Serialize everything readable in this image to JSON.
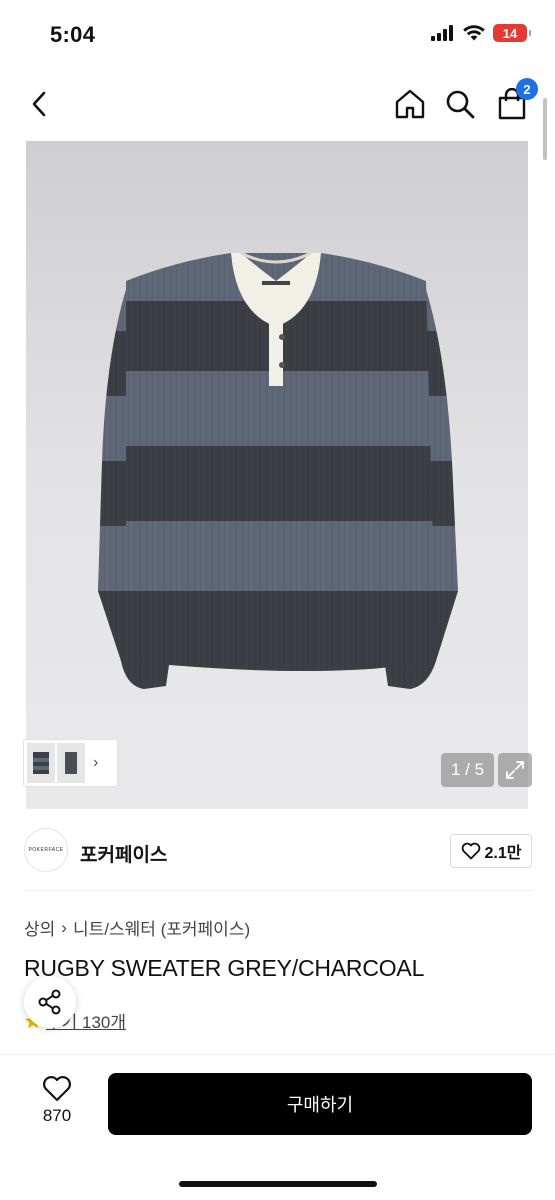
{
  "status_bar": {
    "time": "5:04",
    "battery": "14",
    "icons": [
      "cellular-signal-icon",
      "wifi-icon",
      "battery-icon"
    ]
  },
  "nav": {
    "icons": [
      "back-chevron-icon",
      "home-icon",
      "search-icon",
      "shopping-bag-icon"
    ],
    "cart_count": "2"
  },
  "gallery": {
    "counter": "1 / 5",
    "thumb_chevron": "›"
  },
  "brand": {
    "logo_text": "POKERFACE",
    "name": "포커페이스",
    "likes": "2.1만"
  },
  "breadcrumb": {
    "items": [
      "상의",
      "니트/스웨터 (포커페이스)"
    ],
    "separator": "›"
  },
  "product": {
    "title": "RUGBY SWEATER GREY/CHARCOAL",
    "reviews": "후기 130개"
  },
  "bottom_bar": {
    "wish_count": "870",
    "buy_label": "구매하기"
  },
  "colors": {
    "accent": "#1f6fe5",
    "battery_low": "#e53935",
    "buy_button": "#000000",
    "star": "#f5b400",
    "sweater_dark": "#3c3f45",
    "sweater_light": "#5f6878",
    "collar": "#f2efe6"
  }
}
